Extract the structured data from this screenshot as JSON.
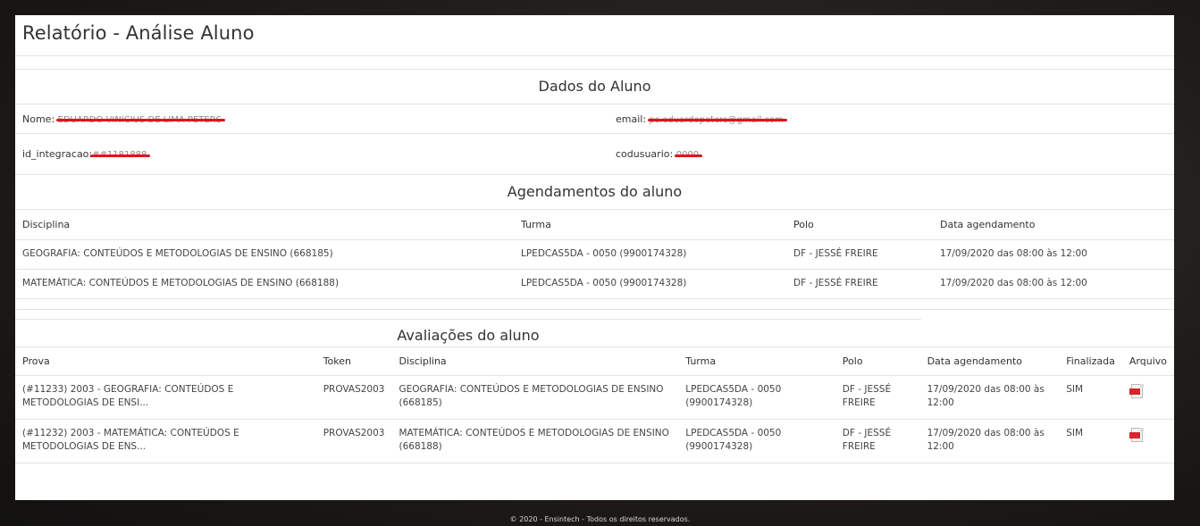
{
  "page": {
    "title": "Relatório - Análise Aluno"
  },
  "dados": {
    "section_title": "Dados do Aluno",
    "nome_label": "Nome:",
    "nome_value": "EDUARDO VINICIUS DE LIMA PETERS",
    "email_label": "email:",
    "email_value": "ps.eduardopeters@gmail.com",
    "id_label": "id_integracao:",
    "id_value": "##1181888",
    "cod_label": "codusuario:",
    "cod_value": "0000"
  },
  "agendamentos": {
    "section_title": "Agendamentos do aluno",
    "headers": [
      "Disciplina",
      "Turma",
      "Polo",
      "Data agendamento"
    ],
    "rows": [
      [
        "GEOGRAFIA: CONTEÚDOS E METODOLOGIAS DE ENSINO (668185)",
        "LPEDCAS5DA - 0050 (9900174328)",
        "DF - JESSÉ FREIRE",
        "17/09/2020 das 08:00 às 12:00"
      ],
      [
        "MATEMÁTICA: CONTEÚDOS E METODOLOGIAS DE ENSINO (668188)",
        "LPEDCAS5DA - 0050 (9900174328)",
        "DF - JESSÉ FREIRE",
        "17/09/2020 das 08:00 às 12:00"
      ]
    ]
  },
  "avaliacoes": {
    "section_title": "Avaliações do aluno",
    "headers": [
      "Prova",
      "Token",
      "Disciplina",
      "Turma",
      "Polo",
      "Data agendamento",
      "Finalizada",
      "Arquivo"
    ],
    "rows": [
      [
        "(#11233) 2003 - GEOGRAFIA: CONTEÚDOS E METODOLOGIAS DE ENSI...",
        "PROVAS2003",
        "GEOGRAFIA: CONTEÚDOS E METODOLOGIAS DE ENSINO (668185)",
        "LPEDCAS5DA - 0050 (9900174328)",
        "DF - JESSÉ FREIRE",
        "17/09/2020 das 08:00 às 12:00",
        "SIM",
        "pdf-icon"
      ],
      [
        "(#11232) 2003 - MATEMÁTICA: CONTEÚDOS E METODOLOGIAS DE ENS...",
        "PROVAS2003",
        "MATEMÁTICA: CONTEÚDOS E METODOLOGIAS DE ENSINO (668188)",
        "LPEDCAS5DA - 0050 (9900174328)",
        "DF - JESSÉ FREIRE",
        "17/09/2020 das 08:00 às 12:00",
        "SIM",
        "pdf-icon"
      ]
    ]
  },
  "footer": {
    "text": "© 2020 - Ensintech - Todos os direitos reservados."
  },
  "colors": {
    "redaction": "#e0141a",
    "pdf": "#d7262c"
  }
}
